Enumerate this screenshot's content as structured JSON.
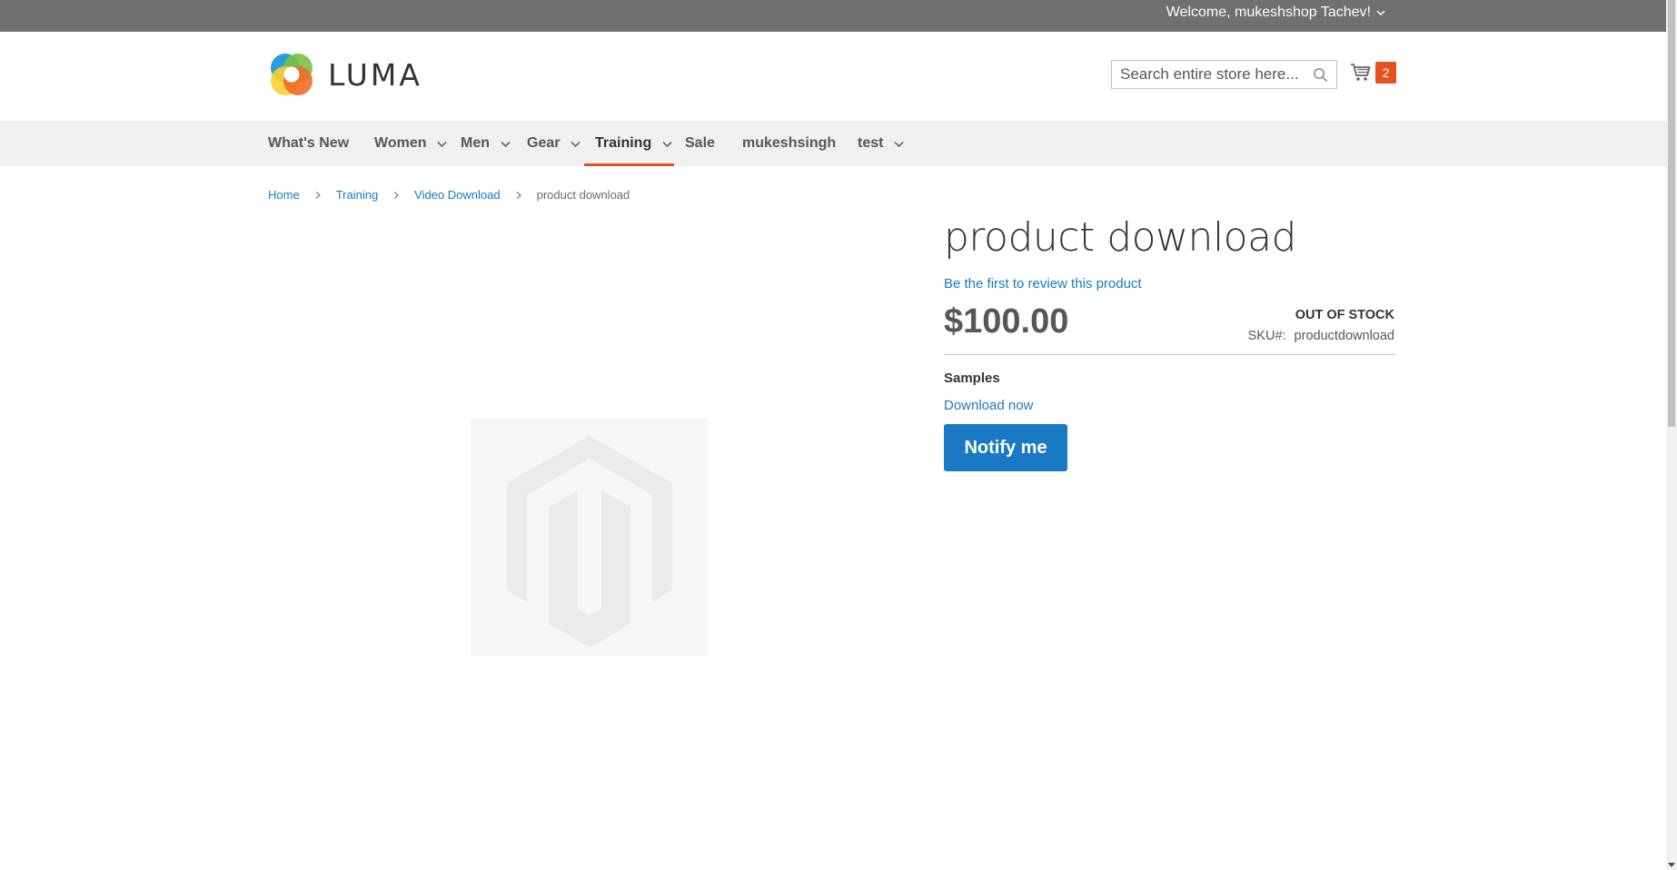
{
  "topbar": {
    "welcome_text": "Welcome, mukeshshop Tachev!"
  },
  "header": {
    "logo_text": "LUMA",
    "search": {
      "placeholder": "Search entire store here..."
    },
    "cart": {
      "count": "2"
    }
  },
  "nav": {
    "items": [
      {
        "label": "What's New"
      },
      {
        "label": "Women"
      },
      {
        "label": "Men"
      },
      {
        "label": "Gear"
      },
      {
        "label": "Training"
      },
      {
        "label": "Sale"
      },
      {
        "label": "mukeshsingh"
      },
      {
        "label": "test"
      }
    ]
  },
  "breadcrumbs": {
    "items": [
      "Home",
      "Training",
      "Video Download"
    ],
    "current": "product download"
  },
  "product": {
    "title": "product download",
    "review_link": "Be the first to review this product",
    "price": "$100.00",
    "stock": "OUT OF STOCK",
    "sku_label": "SKU#:",
    "sku_value": "productdownload",
    "samples_label": "Samples",
    "download_link": "Download now",
    "notify_label": "Notify me"
  },
  "colors": {
    "accent": "#1979c3",
    "nav_active": "#e3521f",
    "topbar": "#6e716e"
  }
}
